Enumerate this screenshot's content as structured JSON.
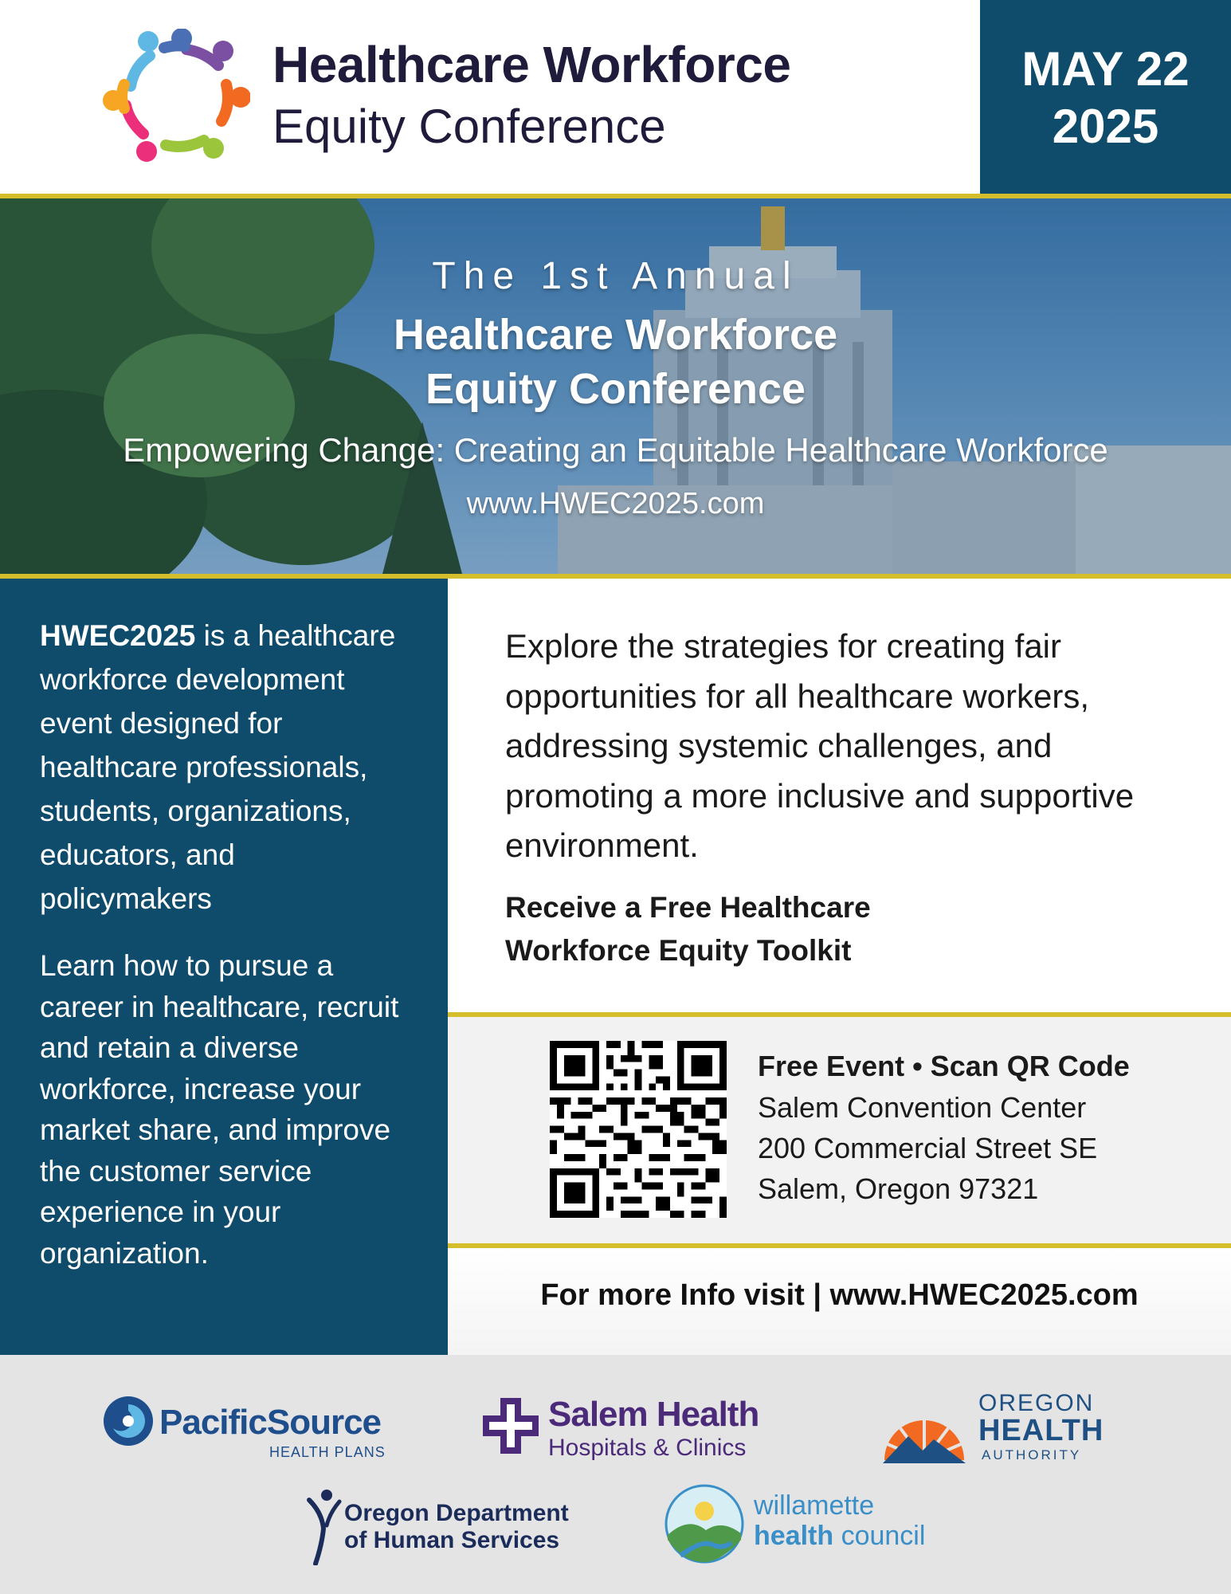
{
  "header": {
    "title_line1": "Healthcare Workforce",
    "title_line2": "Equity Conference",
    "date_line1": "MAY 22",
    "date_line2": "2025"
  },
  "hero": {
    "annual": "The 1st Annual",
    "title_line1": "Healthcare Workforce",
    "title_line2": "Equity Conference",
    "subtitle": "Empowering Change: Creating an Equitable Healthcare Workforce",
    "url": "www.HWEC2025.com"
  },
  "left_panel": {
    "intro_bold": "HWEC2025",
    "intro_rest": " is a healthcare workforce development event designed for healthcare professionals, students, organizations, educators, and policymakers",
    "learn": "Learn how to pursue a career in healthcare, recruit and retain a diverse workforce, increase your market share, and improve the customer service experience in your organization."
  },
  "main": {
    "explore": "Explore the strategies for creating fair opportunities for all healthcare workers, addressing systemic challenges, and promoting a more inclusive and supportive environment.",
    "toolkit_line1": "Receive a Free Healthcare",
    "toolkit_line2": "Workforce Equity Toolkit"
  },
  "event": {
    "headline": "Free Event • Scan QR Code",
    "venue": "Salem Convention Center",
    "street": "200 Commercial Street SE",
    "city": "Salem, Oregon 97321"
  },
  "footer_info": "For more Info visit | www.HWEC2025.com",
  "sponsors": {
    "pacificsource_name": "PacificSource",
    "pacificsource_sub": "HEALTH PLANS",
    "salem_name": "Salem Health",
    "salem_sub": "Hospitals & Clinics",
    "oha_1": "OREGON",
    "oha_2": "HEALTH",
    "oha_3": "AUTHORITY",
    "dhs_1": "Oregon Department",
    "dhs_2": "of Human Services",
    "whc_1": "willamette",
    "whc_2a": "health",
    "whc_2b": " council"
  },
  "colors": {
    "navy": "#0f4c6b",
    "gold_rule": "#d4be2c",
    "title_dark": "#1f1b3a"
  }
}
